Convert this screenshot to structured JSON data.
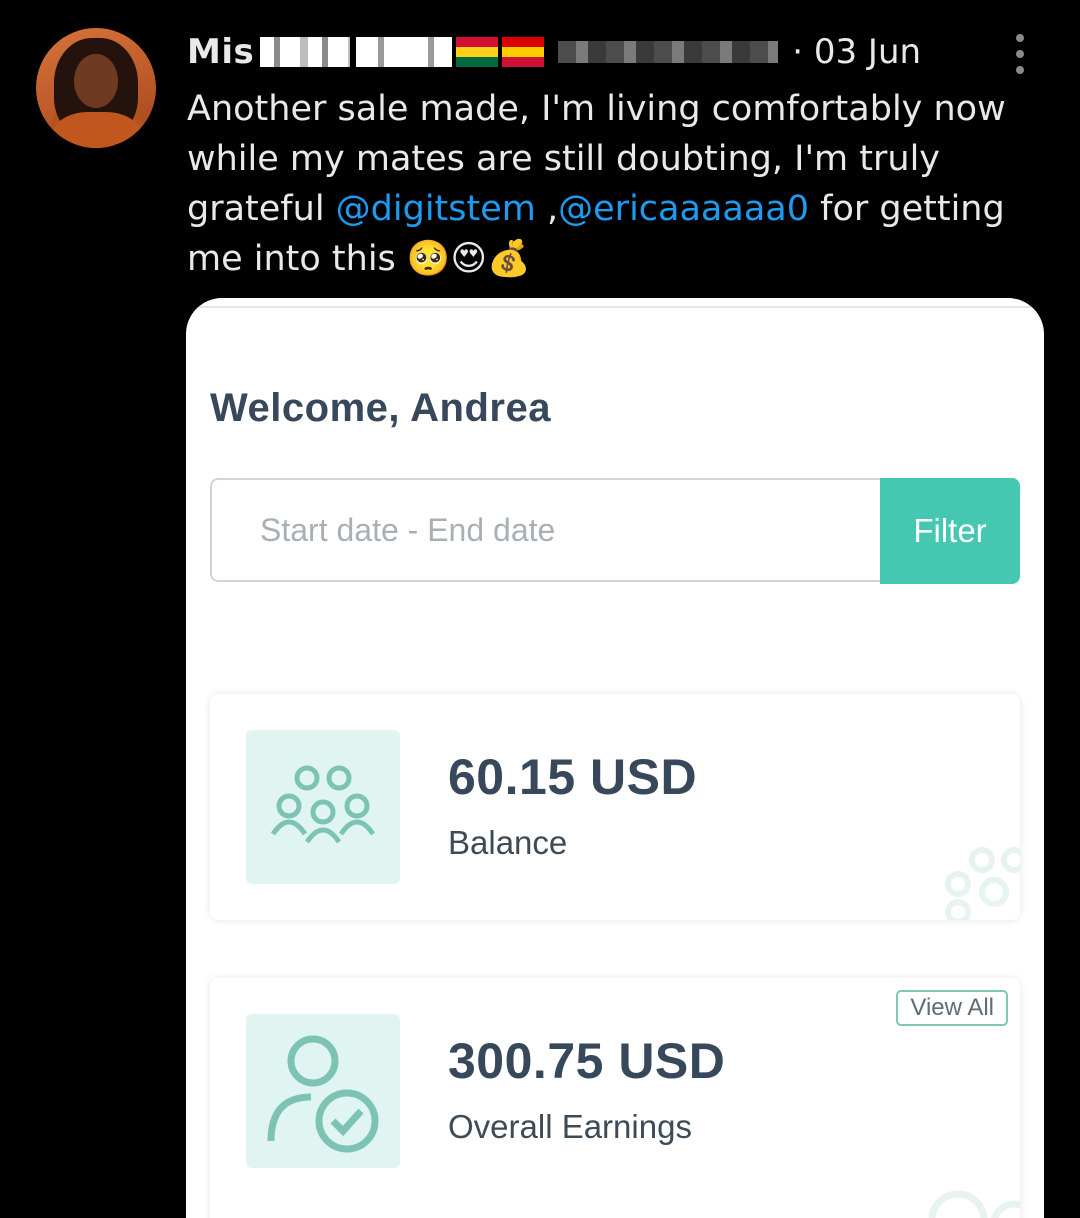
{
  "tweet": {
    "author_prefix": "Mis",
    "date_separator": "·",
    "date": "03 Jun",
    "text_part1": "Another sale made, I'm living comfortably now while my mates are still doubting, I'm truly grateful ",
    "mention1": "@digitstem",
    "between_mentions": " ,",
    "mention2": "@ericaaaaaa0",
    "text_part2": "  for getting me into this 🥺😍💰"
  },
  "dashboard": {
    "welcome": "Welcome, Andrea",
    "date_range_placeholder": "Start date - End date",
    "filter_label": "Filter",
    "balance": {
      "amount": "60.15 USD",
      "label": "Balance"
    },
    "earnings": {
      "amount": "300.75 USD",
      "label": "Overall Earnings",
      "view_all": "View All"
    }
  },
  "colors": {
    "accent": "#45c7b2",
    "mention": "#1d9bf0",
    "icon_bg": "#e0f5f2",
    "icon_stroke": "#7cc3b3"
  },
  "icons": {
    "balance": "users-group-icon",
    "earnings": "user-check-icon",
    "more": "more-vertical-icon"
  }
}
